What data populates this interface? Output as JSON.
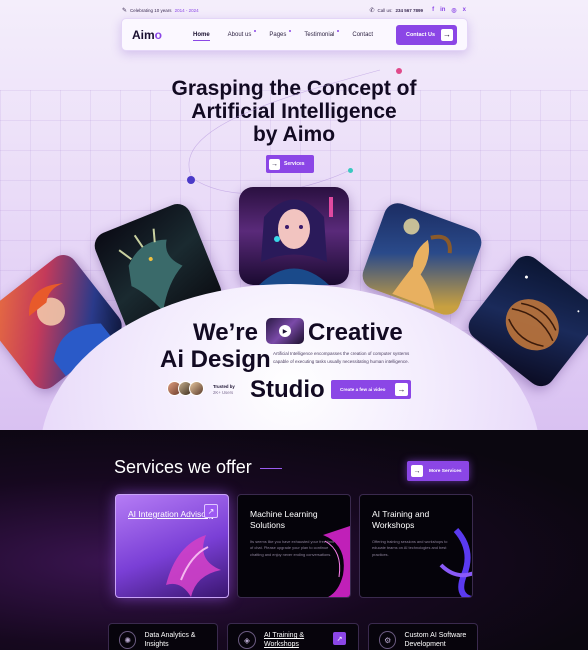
{
  "topbar": {
    "celebrating": "Celebrating 10 years",
    "years": "2014 - 2024",
    "call_label": "Call us:",
    "phone": "234 567 7899",
    "social": [
      "f",
      "in",
      "ig",
      "x"
    ]
  },
  "nav": {
    "logo_main": "Aim",
    "logo_accent": "o",
    "items": [
      "Home",
      "About us",
      "Pages",
      "Testimonial",
      "Contact"
    ],
    "cta": "Contact Us"
  },
  "hero": {
    "title_line1": "Grasping the Concept of",
    "title_line2": "Artificial Intelligence",
    "title_line3": "by Aimo",
    "button": "Services"
  },
  "creative": {
    "word_were": "We’re",
    "word_creative": "Creative",
    "word_ai_design": "Ai Design",
    "word_studio": "Studio",
    "description": "Artificial Intelligence encompasses the creation of computer systems capable of executing tasks usually necessitating human intelligence.",
    "trusted_label": "Trusted by",
    "trusted_count": "2K+ Users",
    "video_button": "Create a few ai video"
  },
  "services": {
    "title": "Services we offer",
    "more_button": "More Services",
    "cards": [
      {
        "title": "AI Integration Advisory",
        "text": ""
      },
      {
        "title": "Machine Learning Solutions",
        "text": "Its seems like you have exhausted your free limit of chat. Please upgrade your plan to continue chatting and enjoy never ending conversations."
      },
      {
        "title": "AI Training and Workshops",
        "text": "Offering training sessions and workshops to educate teams on AI technologies and best practices."
      }
    ],
    "bottom": [
      "Data Analytics & Insights",
      "AI Training & Workshops",
      "Custom AI Software Development"
    ]
  },
  "colors": {
    "accent": "#8b46e6",
    "dark_bg": "#0b0710"
  }
}
